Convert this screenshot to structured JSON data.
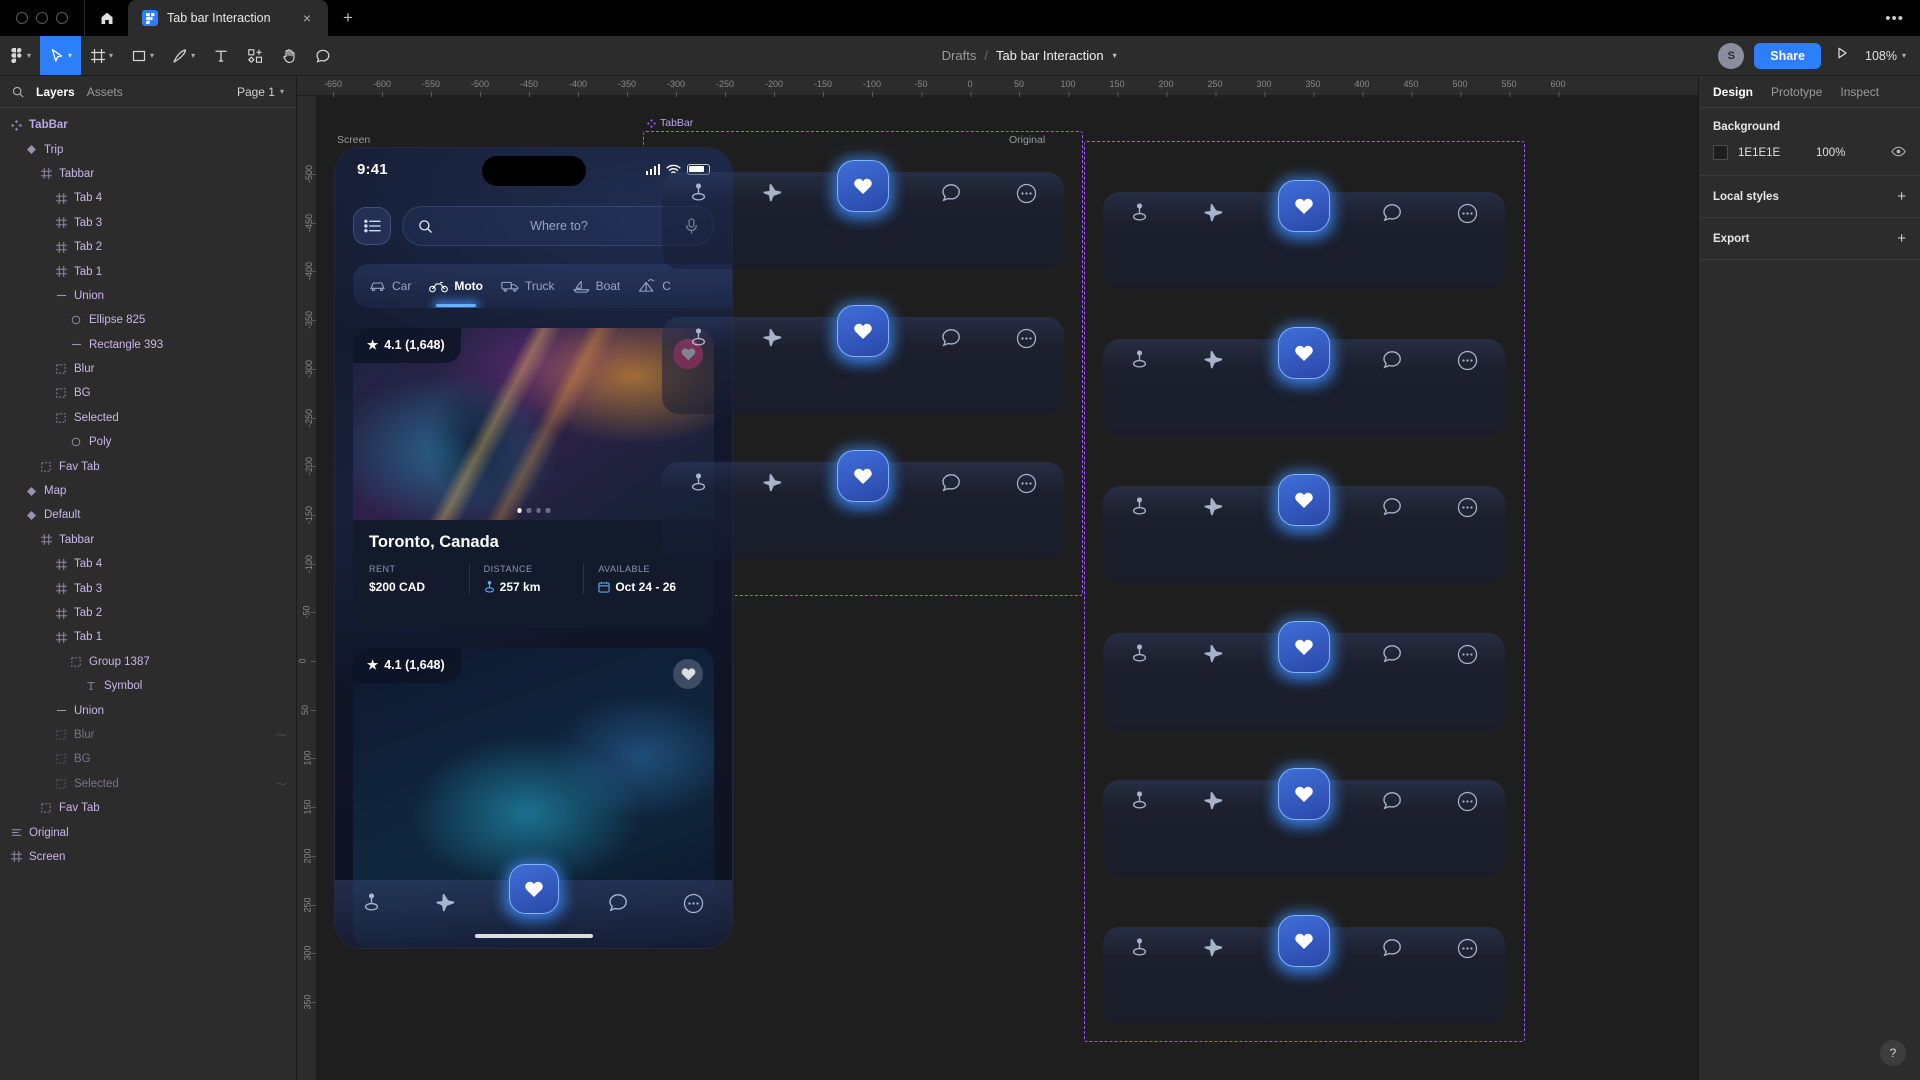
{
  "os": {
    "tab_title": "Tab bar Interaction",
    "close_glyph": "×",
    "new_tab_glyph": "+",
    "overflow_glyph": "•••"
  },
  "toolbar": {
    "tools": [
      {
        "name": "figma-menu-icon",
        "caret": true,
        "active": false
      },
      {
        "name": "move-tool-icon",
        "caret": true,
        "active": true
      },
      {
        "name": "frame-tool-icon",
        "caret": true,
        "active": false
      },
      {
        "name": "shape-tool-icon",
        "caret": true,
        "active": false
      },
      {
        "name": "pen-tool-icon",
        "caret": true,
        "active": false
      },
      {
        "name": "text-tool-icon",
        "caret": false,
        "active": false
      },
      {
        "name": "components-icon",
        "caret": false,
        "active": false
      },
      {
        "name": "hand-tool-icon",
        "caret": false,
        "active": false
      },
      {
        "name": "comment-tool-icon",
        "caret": false,
        "active": false
      }
    ],
    "breadcrumb_root": "Drafts",
    "breadcrumb_sep": "/",
    "breadcrumb_file": "Tab bar Interaction",
    "avatar_initial": "S",
    "share_label": "Share",
    "zoom_level": "108%",
    "accent_color": "#2d7ff9"
  },
  "left_panel": {
    "tab_layers": "Layers",
    "tab_assets": "Assets",
    "page_label": "Page 1",
    "layers": [
      {
        "label": "TabBar",
        "indent": 0,
        "icon": "component-icon",
        "root": true,
        "dim": false,
        "right": ""
      },
      {
        "label": "Trip",
        "indent": 1,
        "icon": "instance-icon",
        "root": false,
        "dim": false,
        "right": ""
      },
      {
        "label": "Tabbar",
        "indent": 2,
        "icon": "frame-icon",
        "root": false,
        "dim": false,
        "right": ""
      },
      {
        "label": "Tab 4",
        "indent": 3,
        "icon": "frame-icon",
        "root": false,
        "dim": false,
        "right": ""
      },
      {
        "label": "Tab 3",
        "indent": 3,
        "icon": "frame-icon",
        "root": false,
        "dim": false,
        "right": ""
      },
      {
        "label": "Tab 2",
        "indent": 3,
        "icon": "frame-icon",
        "root": false,
        "dim": false,
        "right": ""
      },
      {
        "label": "Tab 1",
        "indent": 3,
        "icon": "frame-icon",
        "root": false,
        "dim": false,
        "right": ""
      },
      {
        "label": "Union",
        "indent": 3,
        "icon": "vector-icon",
        "root": false,
        "dim": false,
        "right": ""
      },
      {
        "label": "Ellipse 825",
        "indent": 4,
        "icon": "ellipse-icon",
        "root": false,
        "dim": false,
        "right": ""
      },
      {
        "label": "Rectangle 393",
        "indent": 4,
        "icon": "vector-icon",
        "root": false,
        "dim": false,
        "right": ""
      },
      {
        "label": "Blur",
        "indent": 3,
        "icon": "group-icon",
        "root": false,
        "dim": false,
        "right": ""
      },
      {
        "label": "BG",
        "indent": 3,
        "icon": "group-icon",
        "root": false,
        "dim": false,
        "right": ""
      },
      {
        "label": "Selected",
        "indent": 3,
        "icon": "group-icon",
        "root": false,
        "dim": false,
        "right": ""
      },
      {
        "label": "Poly",
        "indent": 4,
        "icon": "ellipse-icon",
        "root": false,
        "dim": false,
        "right": ""
      },
      {
        "label": "Fav Tab",
        "indent": 2,
        "icon": "group-icon",
        "root": false,
        "dim": false,
        "right": ""
      },
      {
        "label": "Map",
        "indent": 1,
        "icon": "instance-icon",
        "root": false,
        "dim": false,
        "right": ""
      },
      {
        "label": "Default",
        "indent": 1,
        "icon": "instance-icon",
        "root": false,
        "dim": false,
        "right": ""
      },
      {
        "label": "Tabbar",
        "indent": 2,
        "icon": "frame-icon",
        "root": false,
        "dim": false,
        "right": ""
      },
      {
        "label": "Tab 4",
        "indent": 3,
        "icon": "frame-icon",
        "root": false,
        "dim": false,
        "right": ""
      },
      {
        "label": "Tab 3",
        "indent": 3,
        "icon": "frame-icon",
        "root": false,
        "dim": false,
        "right": ""
      },
      {
        "label": "Tab 2",
        "indent": 3,
        "icon": "frame-icon",
        "root": false,
        "dim": false,
        "right": ""
      },
      {
        "label": "Tab 1",
        "indent": 3,
        "icon": "frame-icon",
        "root": false,
        "dim": false,
        "right": ""
      },
      {
        "label": "Group 1387",
        "indent": 4,
        "icon": "group-icon",
        "root": false,
        "dim": false,
        "right": ""
      },
      {
        "label": "Symbol",
        "indent": 5,
        "icon": "text-icon",
        "root": false,
        "dim": false,
        "right": ""
      },
      {
        "label": "Union",
        "indent": 3,
        "icon": "vector-icon",
        "root": false,
        "dim": false,
        "right": ""
      },
      {
        "label": "Blur",
        "indent": 3,
        "icon": "group-icon",
        "root": false,
        "dim": true,
        "right": "〜"
      },
      {
        "label": "BG",
        "indent": 3,
        "icon": "group-icon",
        "root": false,
        "dim": true,
        "right": ""
      },
      {
        "label": "Selected",
        "indent": 3,
        "icon": "group-icon",
        "root": false,
        "dim": true,
        "right": "〜"
      },
      {
        "label": "Fav Tab",
        "indent": 2,
        "icon": "group-icon",
        "root": false,
        "dim": false,
        "right": ""
      },
      {
        "label": "Original",
        "indent": 0,
        "icon": "autolayout-icon",
        "root": false,
        "dim": false,
        "right": ""
      },
      {
        "label": "Screen",
        "indent": 0,
        "icon": "frame-icon",
        "root": false,
        "dim": false,
        "right": ""
      }
    ]
  },
  "right_panel": {
    "tabs": [
      {
        "label": "Design",
        "active": true
      },
      {
        "label": "Prototype",
        "active": false
      },
      {
        "label": "Inspect",
        "active": false
      }
    ],
    "background_title": "Background",
    "background_hex": "1E1E1E",
    "background_opacity": "100%",
    "background_swatch": "#1e1e1e",
    "local_styles_title": "Local styles",
    "export_title": "Export",
    "plus_glyph": "+",
    "help_glyph": "?"
  },
  "canvas": {
    "ruler_h": [
      "-650",
      "-600",
      "-550",
      "-500",
      "-450",
      "-400",
      "-350",
      "-300",
      "-250",
      "-200",
      "-150",
      "-100",
      "-50",
      "0",
      "50",
      "100",
      "150",
      "200",
      "250",
      "300",
      "350",
      "400",
      "450",
      "500",
      "550",
      "600"
    ],
    "ruler_v": [
      "-500",
      "-450",
      "-400",
      "-350",
      "-300",
      "-250",
      "-200",
      "-150",
      "-100",
      "-50",
      "0",
      "50",
      "100",
      "150",
      "200",
      "250",
      "300",
      "350"
    ],
    "frame_screen_label": "Screen",
    "frame_tabbar_label": "TabBar",
    "frame_original_label": "Original",
    "selection_color": "#a259ff"
  },
  "phone": {
    "status_time": "9:41",
    "search_placeholder": "Where to?",
    "chips": [
      {
        "label": "Car",
        "icon": "car-icon",
        "active": false
      },
      {
        "label": "Moto",
        "icon": "moto-icon",
        "active": true
      },
      {
        "label": "Truck",
        "icon": "truck-icon",
        "active": false
      },
      {
        "label": "Boat",
        "icon": "boat-icon",
        "active": false
      },
      {
        "label": "C",
        "icon": "camp-icon",
        "active": false
      }
    ],
    "cards": [
      {
        "rating": "4.1 (1,648)",
        "star_glyph": "★",
        "title": "Toronto, Canada",
        "fav_active": true,
        "meta": [
          {
            "label": "RENT",
            "value": "$200 CAD",
            "icon": ""
          },
          {
            "label": "DISTANCE",
            "value": "257 km",
            "icon": "pin-icon"
          },
          {
            "label": "AVAILABLE",
            "value": "Oct 24 - 26",
            "icon": "calendar-icon"
          }
        ]
      },
      {
        "rating": "4.1 (1,648)",
        "star_glyph": "★",
        "title": "",
        "fav_active": false,
        "meta": []
      }
    ],
    "tabs": [
      {
        "name": "pin-icon"
      },
      {
        "name": "plane-icon"
      },
      {
        "name": "heart-icon"
      },
      {
        "name": "chat-icon"
      },
      {
        "name": "more-icon"
      }
    ]
  },
  "tabbar_variants": {
    "selected_count": 3,
    "original_count": 6
  }
}
